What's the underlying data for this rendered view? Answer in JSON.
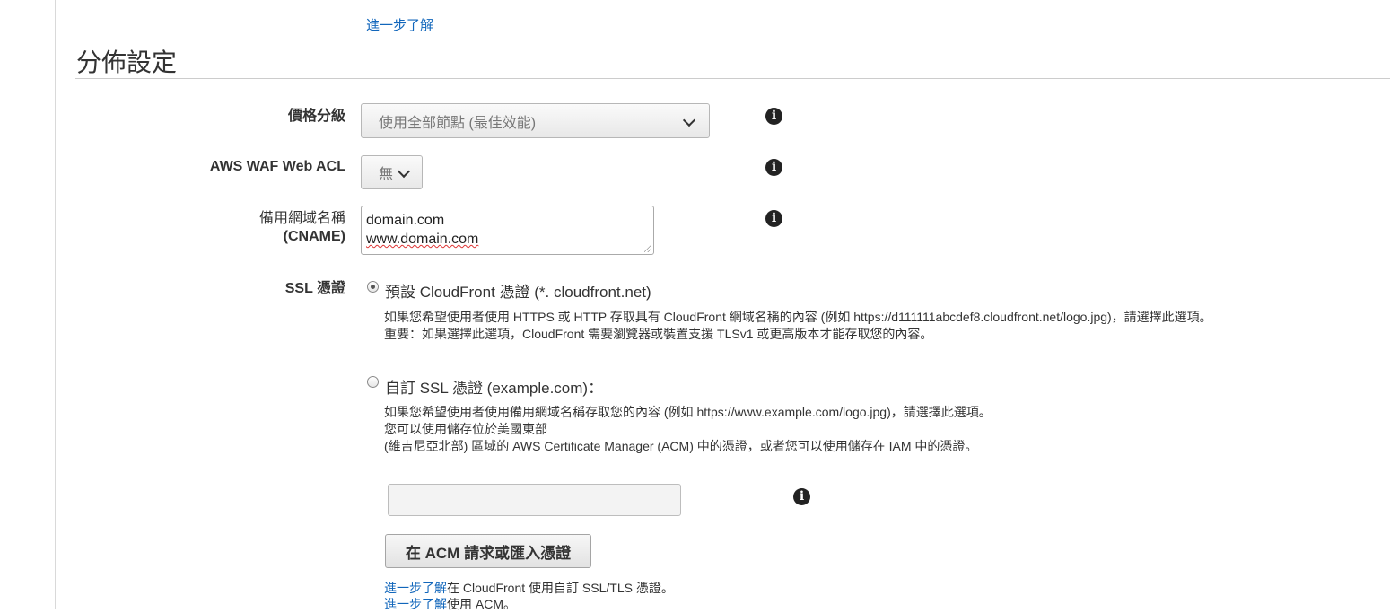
{
  "top_link": "進一步了解",
  "section_title": "分佈設定",
  "price_class": {
    "label": "價格分級",
    "selected": "使用全部節點 (最佳效能)"
  },
  "waf": {
    "label": "AWS WAF Web ACL",
    "selected": "無"
  },
  "cname": {
    "label_line1": "備用網域名稱",
    "label_line2": "(CNAME)",
    "value_line1": "domain.com",
    "value_line2": "www.domain.com"
  },
  "ssl": {
    "label": "SSL 憑證",
    "default_option": {
      "label": "預設 CloudFront 憑證 (*. cloudfront.net)",
      "desc_line1": "如果您希望使用者使用 HTTPS 或 HTTP 存取具有 CloudFront 網域名稱的內容 (例如 https://d111111abcdef8.cloudfront.net/logo.jpg)，請選擇此選項。",
      "desc_line2": "重要：如果選擇此選項，CloudFront 需要瀏覽器或裝置支援 TLSv1 或更高版本才能存取您的內容。",
      "checked": true
    },
    "custom_option": {
      "label": "自訂 SSL 憑證 (example.com)：",
      "desc_line1": "如果您希望使用者使用備用網域名稱存取您的內容 (例如 https://www.example.com/logo.jpg)，請選擇此選項。",
      "desc_line2": "您可以使用儲存位於美國東部",
      "desc_line3": "(維吉尼亞北部) 區域的 AWS Certificate Manager (ACM) 中的憑證，或者您可以使用儲存在 IAM 中的憑證。",
      "checked": false
    },
    "cert_input_value": "",
    "acm_button": "在 ACM 請求或匯入憑證",
    "learn_more_1_link": "進一步了解",
    "learn_more_1_text": "在 CloudFront 使用自訂 SSL/TLS 憑證。",
    "learn_more_2_link": "進一步了解",
    "learn_more_2_text": "使用 ACM。"
  },
  "icons": {
    "info": "info-icon",
    "chevron": "chevron-down-icon"
  },
  "colors": {
    "link": "#1166bb",
    "text": "#333333"
  }
}
